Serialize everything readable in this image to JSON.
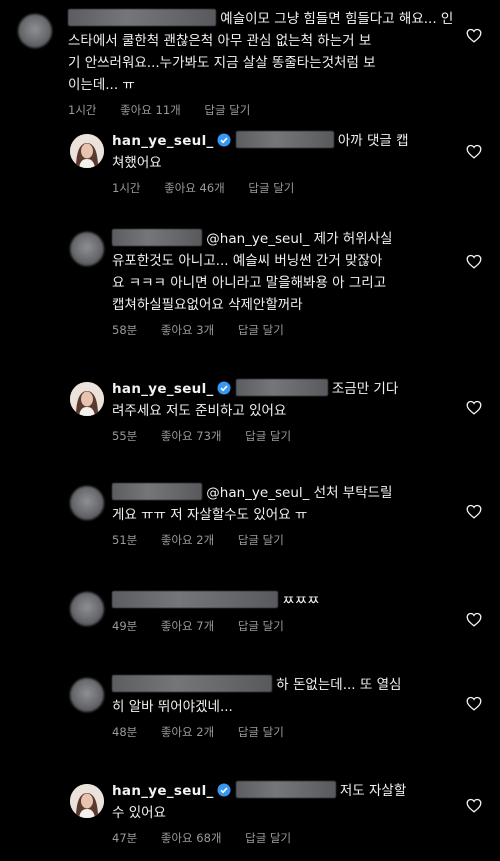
{
  "colors": {
    "background": "#000000",
    "text": "#f2f2f2",
    "meta": "#9a9a9a",
    "verified": "#3897f0"
  },
  "icons": {
    "like": "heart-outline-icon",
    "verified": "verified-badge-icon"
  },
  "comments": [
    {
      "author": "",
      "verified": false,
      "text": "예슬이모 그냥 힘들면 힘들다고 해요... 인\n스타에서 쿨한척 괜찮은척 아무 관심 없는척 하는거 보\n기 안쓰러워요...누가봐도 지금 살살 똥줄타는것처럼 보\n이는데... ㅠ",
      "time": "1시간",
      "likes": "좋아요 11개",
      "reply": "답글 달기"
    },
    {
      "author": "han_ye_seul_",
      "verified": true,
      "text": "아까 댓글 캡\n쳐했어요",
      "time": "1시간",
      "likes": "좋아요 46개",
      "reply": "답글 달기"
    },
    {
      "author": "",
      "verified": false,
      "text": "@han_ye_seul_ 제가 허위사실\n유포한것도 아니고... 예슬씨 버닝썬 간거 맞잖아\n요 ㅋㅋㅋ 아니면 아니라고 말을해봐용 아 그리고\n캡쳐하실필요없어요 삭제안할꺼라",
      "time": "58분",
      "likes": "좋아요 3개",
      "reply": "답글 달기"
    },
    {
      "author": "han_ye_seul_",
      "verified": true,
      "text": "조금만 기다\n려주세요 저도 준비하고 있어요",
      "time": "55분",
      "likes": "좋아요 73개",
      "reply": "답글 달기"
    },
    {
      "author": "",
      "verified": false,
      "text": "@han_ye_seul_ 선처 부탁드릴\n게요 ㅠㅠ 저 자살할수도 있어요 ㅠ",
      "time": "51분",
      "likes": "좋아요 2개",
      "reply": "답글 달기"
    },
    {
      "author": "",
      "verified": false,
      "text": "ㅉㅉㅉ",
      "time": "49분",
      "likes": "좋아요 7개",
      "reply": "답글 달기"
    },
    {
      "author": "",
      "verified": false,
      "text": "하 돈없는데... 또 열심\n히 알바 뛰어야겠네...",
      "time": "48분",
      "likes": "좋아요 2개",
      "reply": "답글 달기"
    },
    {
      "author": "han_ye_seul_",
      "verified": true,
      "text": "저도 자살할\n수 있어요",
      "time": "47분",
      "likes": "좋아요 68개",
      "reply": "답글 달기"
    }
  ]
}
